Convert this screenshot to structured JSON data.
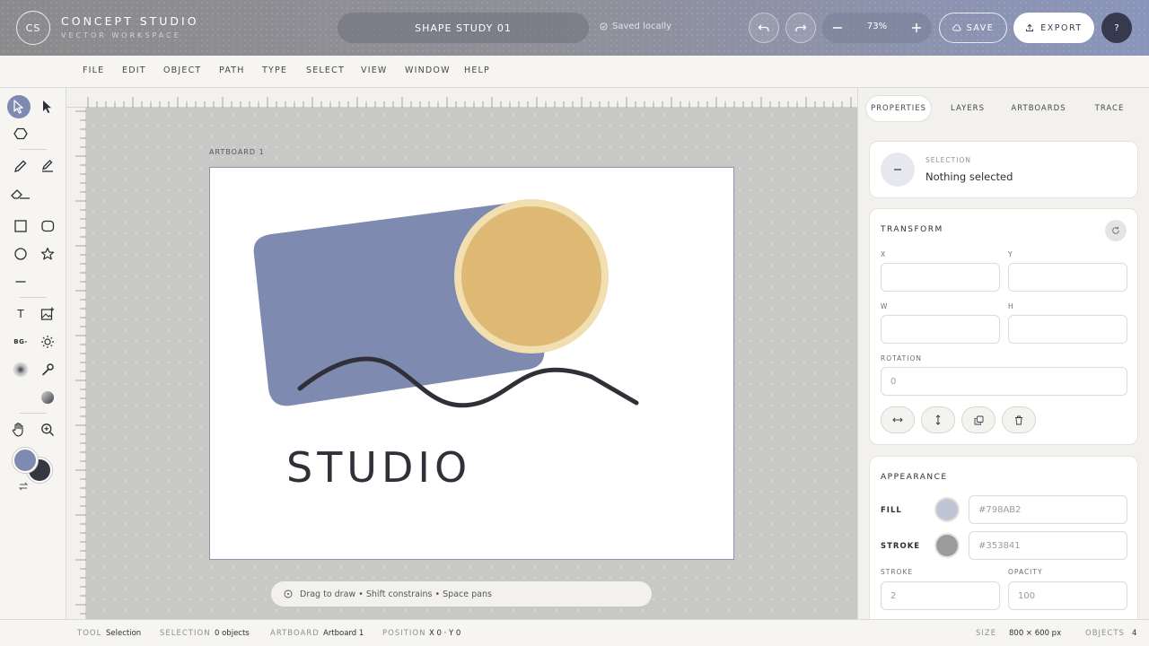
{
  "header": {
    "logo_initials": "CS",
    "brand_title": "CONCEPT STUDIO",
    "brand_subtitle": "VECTOR WORKSPACE",
    "document_title": "SHAPE STUDY 01",
    "saved_status": "Saved locally",
    "zoom": "73%",
    "save_label": "SAVE",
    "export_label": "EXPORT",
    "help_label": "?"
  },
  "menu": [
    "FILE",
    "EDIT",
    "OBJECT",
    "PATH",
    "TYPE",
    "SELECT",
    "VIEW",
    "WINDOW",
    "HELP"
  ],
  "toolbar": {
    "active_tool": "selection",
    "bg_tool_label": "BG-",
    "text_tool_label": "T",
    "fill_color": "#7E8AB0",
    "stroke_color": "#353841"
  },
  "canvas": {
    "artboard_label": "ARTBOARD 1",
    "artboard_text": "STUDIO",
    "hint": "Drag to draw • Shift constrains • Space pans",
    "colors": {
      "rect": "#7E8AB0",
      "circle_fill": "#DDB974",
      "circle_ring": "#F1DEB1",
      "wave": "#2F3038",
      "text": "#2F3038"
    }
  },
  "panel": {
    "tabs": [
      "PROPERTIES",
      "LAYERS",
      "ARTBOARDS",
      "TRACE"
    ],
    "active_tab": "PROPERTIES",
    "selection_label": "SELECTION",
    "selection_value": "Nothing selected",
    "transform_title": "TRANSFORM",
    "x_label": "X",
    "y_label": "Y",
    "w_label": "W",
    "h_label": "H",
    "rotation_label": "ROTATION",
    "rotation_value": "0",
    "appearance_title": "APPEARANCE",
    "fill_label": "FILL",
    "fill_placeholder": "#798AB2",
    "stroke_label": "STROKE",
    "stroke_placeholder": "#353841",
    "stroke_width_label": "STROKE",
    "stroke_width_value": "2",
    "opacity_label": "OPACITY",
    "opacity_value": "100"
  },
  "status": {
    "tool_label": "TOOL",
    "tool_value": "Selection",
    "selection_label": "SELECTION",
    "selection_value": "0 objects",
    "artboard_label": "ARTBOARD",
    "artboard_value": "Artboard 1",
    "position_label": "POSITION",
    "position_value": "X 0 · Y 0",
    "size_label": "SIZE",
    "size_value": "800 × 600 px",
    "objects_label": "OBJECTS",
    "objects_value": "4"
  }
}
